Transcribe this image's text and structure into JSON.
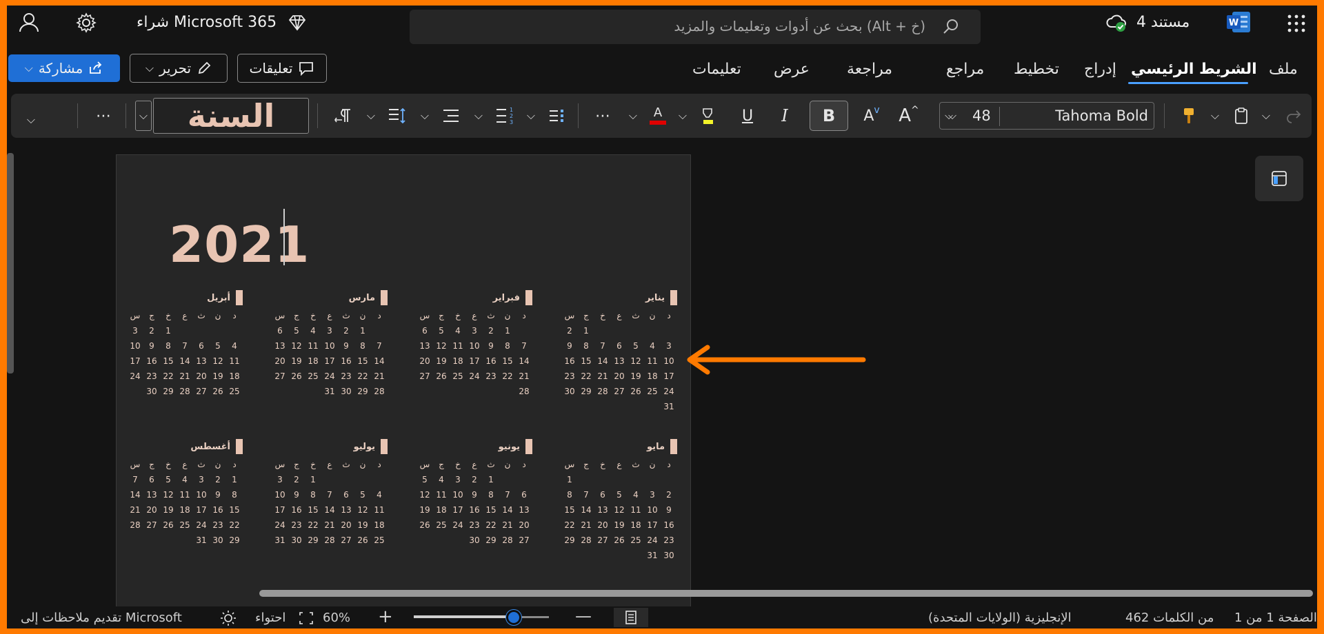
{
  "titlebar": {
    "app_icon": "word-icon",
    "doc_title": "مستند 4",
    "save_status_icon": "cloud-saved-icon",
    "search_placeholder": "بحث عن أدوات وتعليمات والمزيد (Alt + خ)",
    "buy_label": "شراء Microsoft 365",
    "diamond_icon": "diamond-icon",
    "settings_icon": "gear-icon",
    "account_icon": "person-icon",
    "apps_icon": "app-launcher-icon"
  },
  "tabs": [
    "ملف",
    "الشريط الرئيسي",
    "إدراج",
    "تخطيط",
    "مراجع",
    "مراجعة",
    "عرض",
    "تعليمات"
  ],
  "active_tab": "الشريط الرئيسي",
  "actions": {
    "comments_label": "تعليقات",
    "edit_label": "تحرير",
    "share_label": "مشاركة"
  },
  "ribbon": {
    "font_name": "Tahoma Bold",
    "font_size": "48",
    "style_preview": "السنة",
    "bold": "B",
    "italic": "I",
    "underline": "U",
    "grow_font": "A",
    "shrink_font": "A",
    "font_color": "A",
    "more": "⋯"
  },
  "document": {
    "year": "2021",
    "weekday_headers": [
      "د",
      "ن",
      "ث",
      "ع",
      "خ",
      "ج",
      "س"
    ],
    "months": [
      {
        "name": "يناير",
        "start": 5,
        "days": 31
      },
      {
        "name": "فبراير",
        "start": 1,
        "days": 28
      },
      {
        "name": "مارس",
        "start": 1,
        "days": 31
      },
      {
        "name": "أبريل",
        "start": 4,
        "days": 30
      },
      {
        "name": "مايو",
        "start": 6,
        "days": 31
      },
      {
        "name": "يونيو",
        "start": 2,
        "days": 30
      },
      {
        "name": "يوليو",
        "start": 4,
        "days": 31
      },
      {
        "name": "أغسطس",
        "start": 0,
        "days": 31
      }
    ]
  },
  "statusbar": {
    "page": "الصفحة 1 من 1",
    "words": "462 من الكلمات",
    "language": "الإنجليزية (الولايات المتحدة)",
    "zoom": "60%",
    "zoom_level": 0.6,
    "fit_label": "احتواء",
    "feedback": "تقديم ملاحظات إلى Microsoft"
  }
}
